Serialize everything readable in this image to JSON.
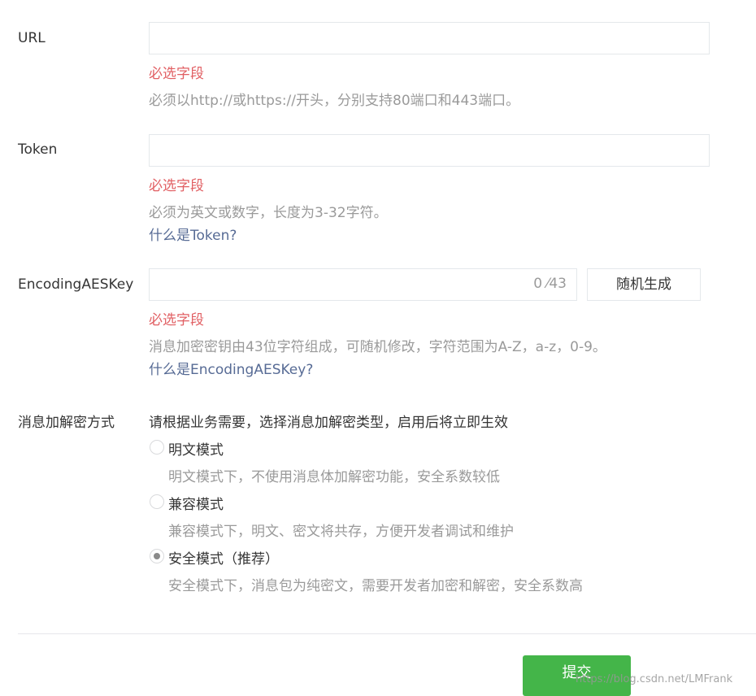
{
  "form": {
    "url": {
      "label": "URL",
      "value": "",
      "error": "必选字段",
      "tip": "必须以http://或https://开头，分别支持80端口和443端口。"
    },
    "token": {
      "label": "Token",
      "value": "",
      "error": "必选字段",
      "tip": "必须为英文或数字，长度为3-32字符。",
      "link": "什么是Token?"
    },
    "aeskey": {
      "label": "EncodingAESKey",
      "value": "",
      "counter": "0 ⁄43",
      "generate_label": "随机生成",
      "error": "必选字段",
      "tip": "消息加密密钥由43位字符组成，可随机修改，字符范围为A-Z，a-z，0-9。",
      "link": "什么是EncodingAESKey?"
    },
    "encryption": {
      "label": "消息加解密方式",
      "description": "请根据业务需要，选择消息加解密类型，启用后将立即生效",
      "options": [
        {
          "label": "明文模式",
          "tip": "明文模式下，不使用消息体加解密功能，安全系数较低",
          "selected": false
        },
        {
          "label": "兼容模式",
          "tip": "兼容模式下，明文、密文将共存，方便开发者调试和维护",
          "selected": false
        },
        {
          "label": "安全模式（推荐）",
          "tip": "安全模式下，消息包为纯密文，需要开发者加密和解密，安全系数高",
          "selected": true
        }
      ]
    }
  },
  "footer": {
    "submit_label": "提交",
    "watermark": "https://blog.csdn.net/LMFrank"
  },
  "colors": {
    "error": "#e15f63",
    "link": "#576b95",
    "primary": "#44b549"
  }
}
